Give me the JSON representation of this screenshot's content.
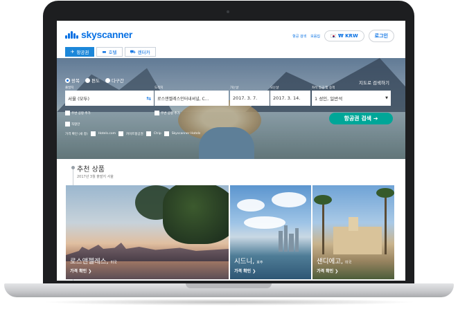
{
  "brand": {
    "name": "skyscanner",
    "accent": "#0770e3",
    "button_color": "#00a698"
  },
  "header": {
    "links": [
      "항공 검색",
      "모음집"
    ],
    "currency": "₩ KRW",
    "login": "로그인"
  },
  "tabs": [
    {
      "label": "항공권",
      "icon": "plane-icon",
      "active": true
    },
    {
      "label": "호텔",
      "icon": "bed-icon",
      "active": false
    },
    {
      "label": "렌터카",
      "icon": "car-icon",
      "active": false
    }
  ],
  "search": {
    "trip_types": [
      {
        "label": "왕복",
        "selected": true
      },
      {
        "label": "편도",
        "selected": false
      },
      {
        "label": "다구간",
        "selected": false
      }
    ],
    "map_search": "지도로 검색하기",
    "from_label": "출발지",
    "from_value": "서울 (모두)",
    "to_label": "도착지",
    "to_value": "로스앤젤레스인터내셔널, C...",
    "depart_label": "가는날",
    "depart_value": "2017. 3. 7.",
    "return_label": "오는날",
    "return_value": "2017. 3. 14.",
    "cabin_label": "좌석 등급 및 승객",
    "cabin_value": "1 성인, 일반석",
    "nearby_from": "주변 공항 추가",
    "nearby_to": "주변 공항 추가",
    "direct": "직항만",
    "submit": "항공권 검색 ➔",
    "compare_label": "가격 확인 (새 창)",
    "compare_sites": [
      "Hotels.com",
      "카이트항공권",
      "Ctrip",
      "Skyscanner Hotels"
    ]
  },
  "recommended": {
    "title": "추천 상품",
    "subtitle": "2017년 3월   출발지 서울",
    "cards": [
      {
        "city": "로스앤젤레스,",
        "country": "미국",
        "link": "가격 확인 ❯"
      },
      {
        "city": "시드니,",
        "country": "호주",
        "link": "가격 확인 ❯"
      },
      {
        "city": "샌디에고,",
        "country": "미국",
        "link": "가격 확인 ❯"
      }
    ]
  }
}
